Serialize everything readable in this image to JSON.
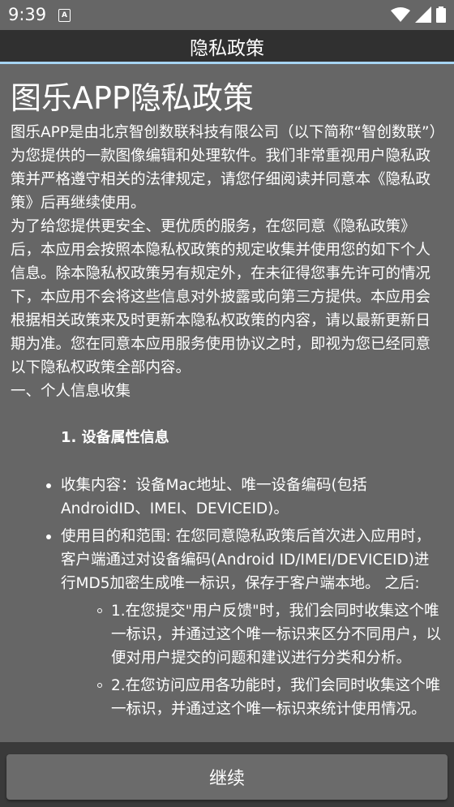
{
  "status_bar": {
    "time": "9:39",
    "notification_glyph": "A",
    "icons": [
      "wifi-icon",
      "signal-icon",
      "battery-icon"
    ]
  },
  "app_bar": {
    "title": "隐私政策"
  },
  "doc": {
    "heading": "图乐APP隐私政策",
    "para1": "图乐APP是由北京智创数联科技有限公司（以下简称“智创数联”）为您提供的一款图像编辑和处理软件。我们非常重视用户隐私政策并严格遵守相关的法律规定，请您仔细阅读并同意本《隐私政策》后再继续使用。",
    "para2": "为了给您提供更安全、更优质的服务，在您同意《隐私政策》后，本应用会按照本隐私权政策的规定收集并使用您的如下个人信息。除本隐私权政策另有规定外，在未征得您事先许可的情况下，本应用不会将这些信息对外披露或向第三方提供。本应用会根据相关政策来及时更新本隐私权政策的内容，请以最新更新日期为准。您在同意本应用服务使用协议之时，即视为您已经同意以下隐私权政策全部内容。",
    "section1": "一、个人信息收集",
    "subheading1": "1. 设备属性信息",
    "bullets": [
      "收集内容：设备Mac地址、唯一设备编码(包括AndroidID、IMEI、DEVICEID)。",
      "使用目的和范围: 在您同意隐私政策后首次进入应用时，客户端通过对设备编码(Android ID/IMEI/DEVICEID)进行MD5加密生成唯一标识，保存于客户端本地。 之后:"
    ],
    "sub_bullets": [
      "1.在您提交\"用户反馈\"时，我们会同时收集这个唯一标识，并通过这个唯一标识来区分不同用户，以便对用户提交的问题和建议进行分类和分析。",
      "2.在您访问应用各功能时，我们会同时收集这个唯一标识，并通过这个唯一标识来统计使用情况。"
    ]
  },
  "footer": {
    "continue_label": "继续"
  },
  "colors": {
    "background": "#666666",
    "app_bar": "#303030",
    "accent_line": "#a6d4f2",
    "button": "#6b6b6b"
  }
}
